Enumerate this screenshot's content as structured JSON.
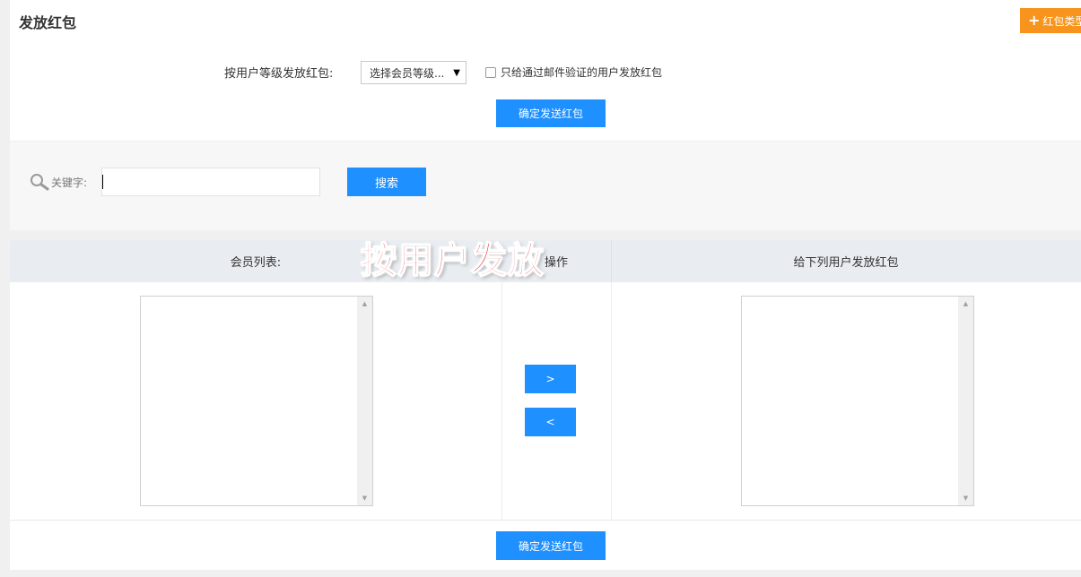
{
  "header": {
    "title": "发放红包",
    "add_type_label": "红包类型"
  },
  "by_level": {
    "label": "按用户等级发放红包:",
    "select_value": "选择会员等级...",
    "email_verified_label": "只给通过邮件验证的用户发放红包",
    "submit_label": "确定发送红包"
  },
  "search": {
    "keyword_label": "关键字:",
    "keyword_value": "",
    "button_label": "搜索"
  },
  "table": {
    "col_members": "会员列表:",
    "col_actions": "操作",
    "col_recipients": "给下列用户发放红包",
    "add_label": ">",
    "remove_label": "<",
    "submit_label": "确定发送红包"
  },
  "overlay": {
    "caption": "按用户发放"
  },
  "colors": {
    "primary_blue": "#1e90ff",
    "accent_orange": "#f7941d",
    "caption_red": "#e8222a"
  }
}
